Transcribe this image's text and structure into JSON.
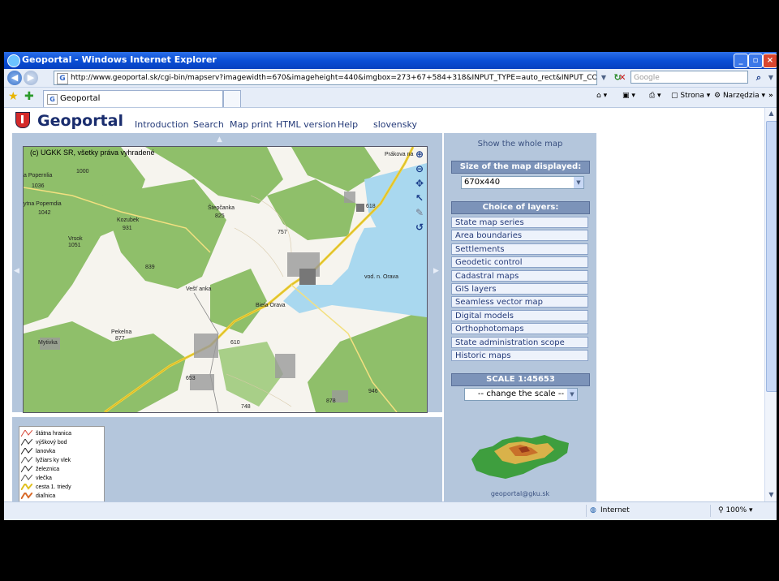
{
  "window": {
    "title": "Geoportal - Windows Internet Explorer",
    "address": "http://www.geoportal.sk/cgi-bin/mapserv?imagewidth=670&imageheight=440&imgbox=273+67+584+318&INPUT_TYPE=auto_rect&INPUT_COORD=273%2C67%3B584%2C31",
    "search_placeholder": "Google",
    "tab_label": "Geoportal",
    "page_menu": "Strona",
    "tools_menu": "Narzędzia",
    "status_zone": "Internet",
    "zoom": "100%"
  },
  "site": {
    "logo": "Geoportal",
    "nav": [
      "Introduction",
      "Search",
      "Map print",
      "HTML version",
      "Help",
      "slovensky"
    ]
  },
  "map": {
    "copyright": "(c) UGKK SR, všetky práva vyhradené",
    "labels": {
      "poprad_lbl": "a Popernlia",
      "n1000": "1000",
      "n1036": "1036",
      "vysna": "ytna Popemdia",
      "n1042": "1042",
      "kozubek": "Kozubek",
      "n931": "931",
      "vrsok": "Vrsok",
      "n1051": "1051",
      "stepcanka": "Štepčanka",
      "n825": "825",
      "n618": "618",
      "n757": "757",
      "n839": "839",
      "vestanka": "Vešť anka",
      "bila_orava": "Biela Orava",
      "vod_orava": "vod. n. Orava",
      "pekelna": "Pekelna",
      "n877": "877",
      "n610": "610",
      "n653": "653",
      "n748": "748",
      "n878": "878",
      "n946": "946",
      "prakova": "Prákova na",
      "mytivka": "Mytivka"
    }
  },
  "legend": [
    {
      "label": "štátna hranica",
      "color": "#d84a3a"
    },
    {
      "label": "výškový bod",
      "color": "#333333"
    },
    {
      "label": "lanovka",
      "color": "#222222"
    },
    {
      "label": "lyžiars ky vlek",
      "color": "#555555"
    },
    {
      "label": "železnica",
      "color": "#333333"
    },
    {
      "label": "vlečka",
      "color": "#555555"
    },
    {
      "label": "cesta 1. triedy",
      "color": "#e0c020"
    },
    {
      "label": "diaľnica",
      "color": "#d86a2a"
    }
  ],
  "panel": {
    "show_whole": "Show the whole map",
    "size_heading": "Size of the map displayed:",
    "size_value": "670x440",
    "layers_heading": "Choice of layers:",
    "layers": [
      "State map series",
      "Area boundaries",
      "Settlements",
      "Geodetic control",
      "Cadastral maps",
      "GIS layers",
      "Seamless vector map",
      "Digital models",
      "Orthophotomaps",
      "State administration scope",
      "Historic maps"
    ],
    "scale_heading": "SCALE 1:45653",
    "scale_select": "-- change the scale --",
    "email": "geoportal@gku.sk"
  },
  "colors": {
    "forest": "#8fbf6a",
    "water": "#a9d8ef",
    "road": "#f0d33a",
    "panel": "#b4c6dc",
    "panel_heading": "#7c93b9"
  }
}
